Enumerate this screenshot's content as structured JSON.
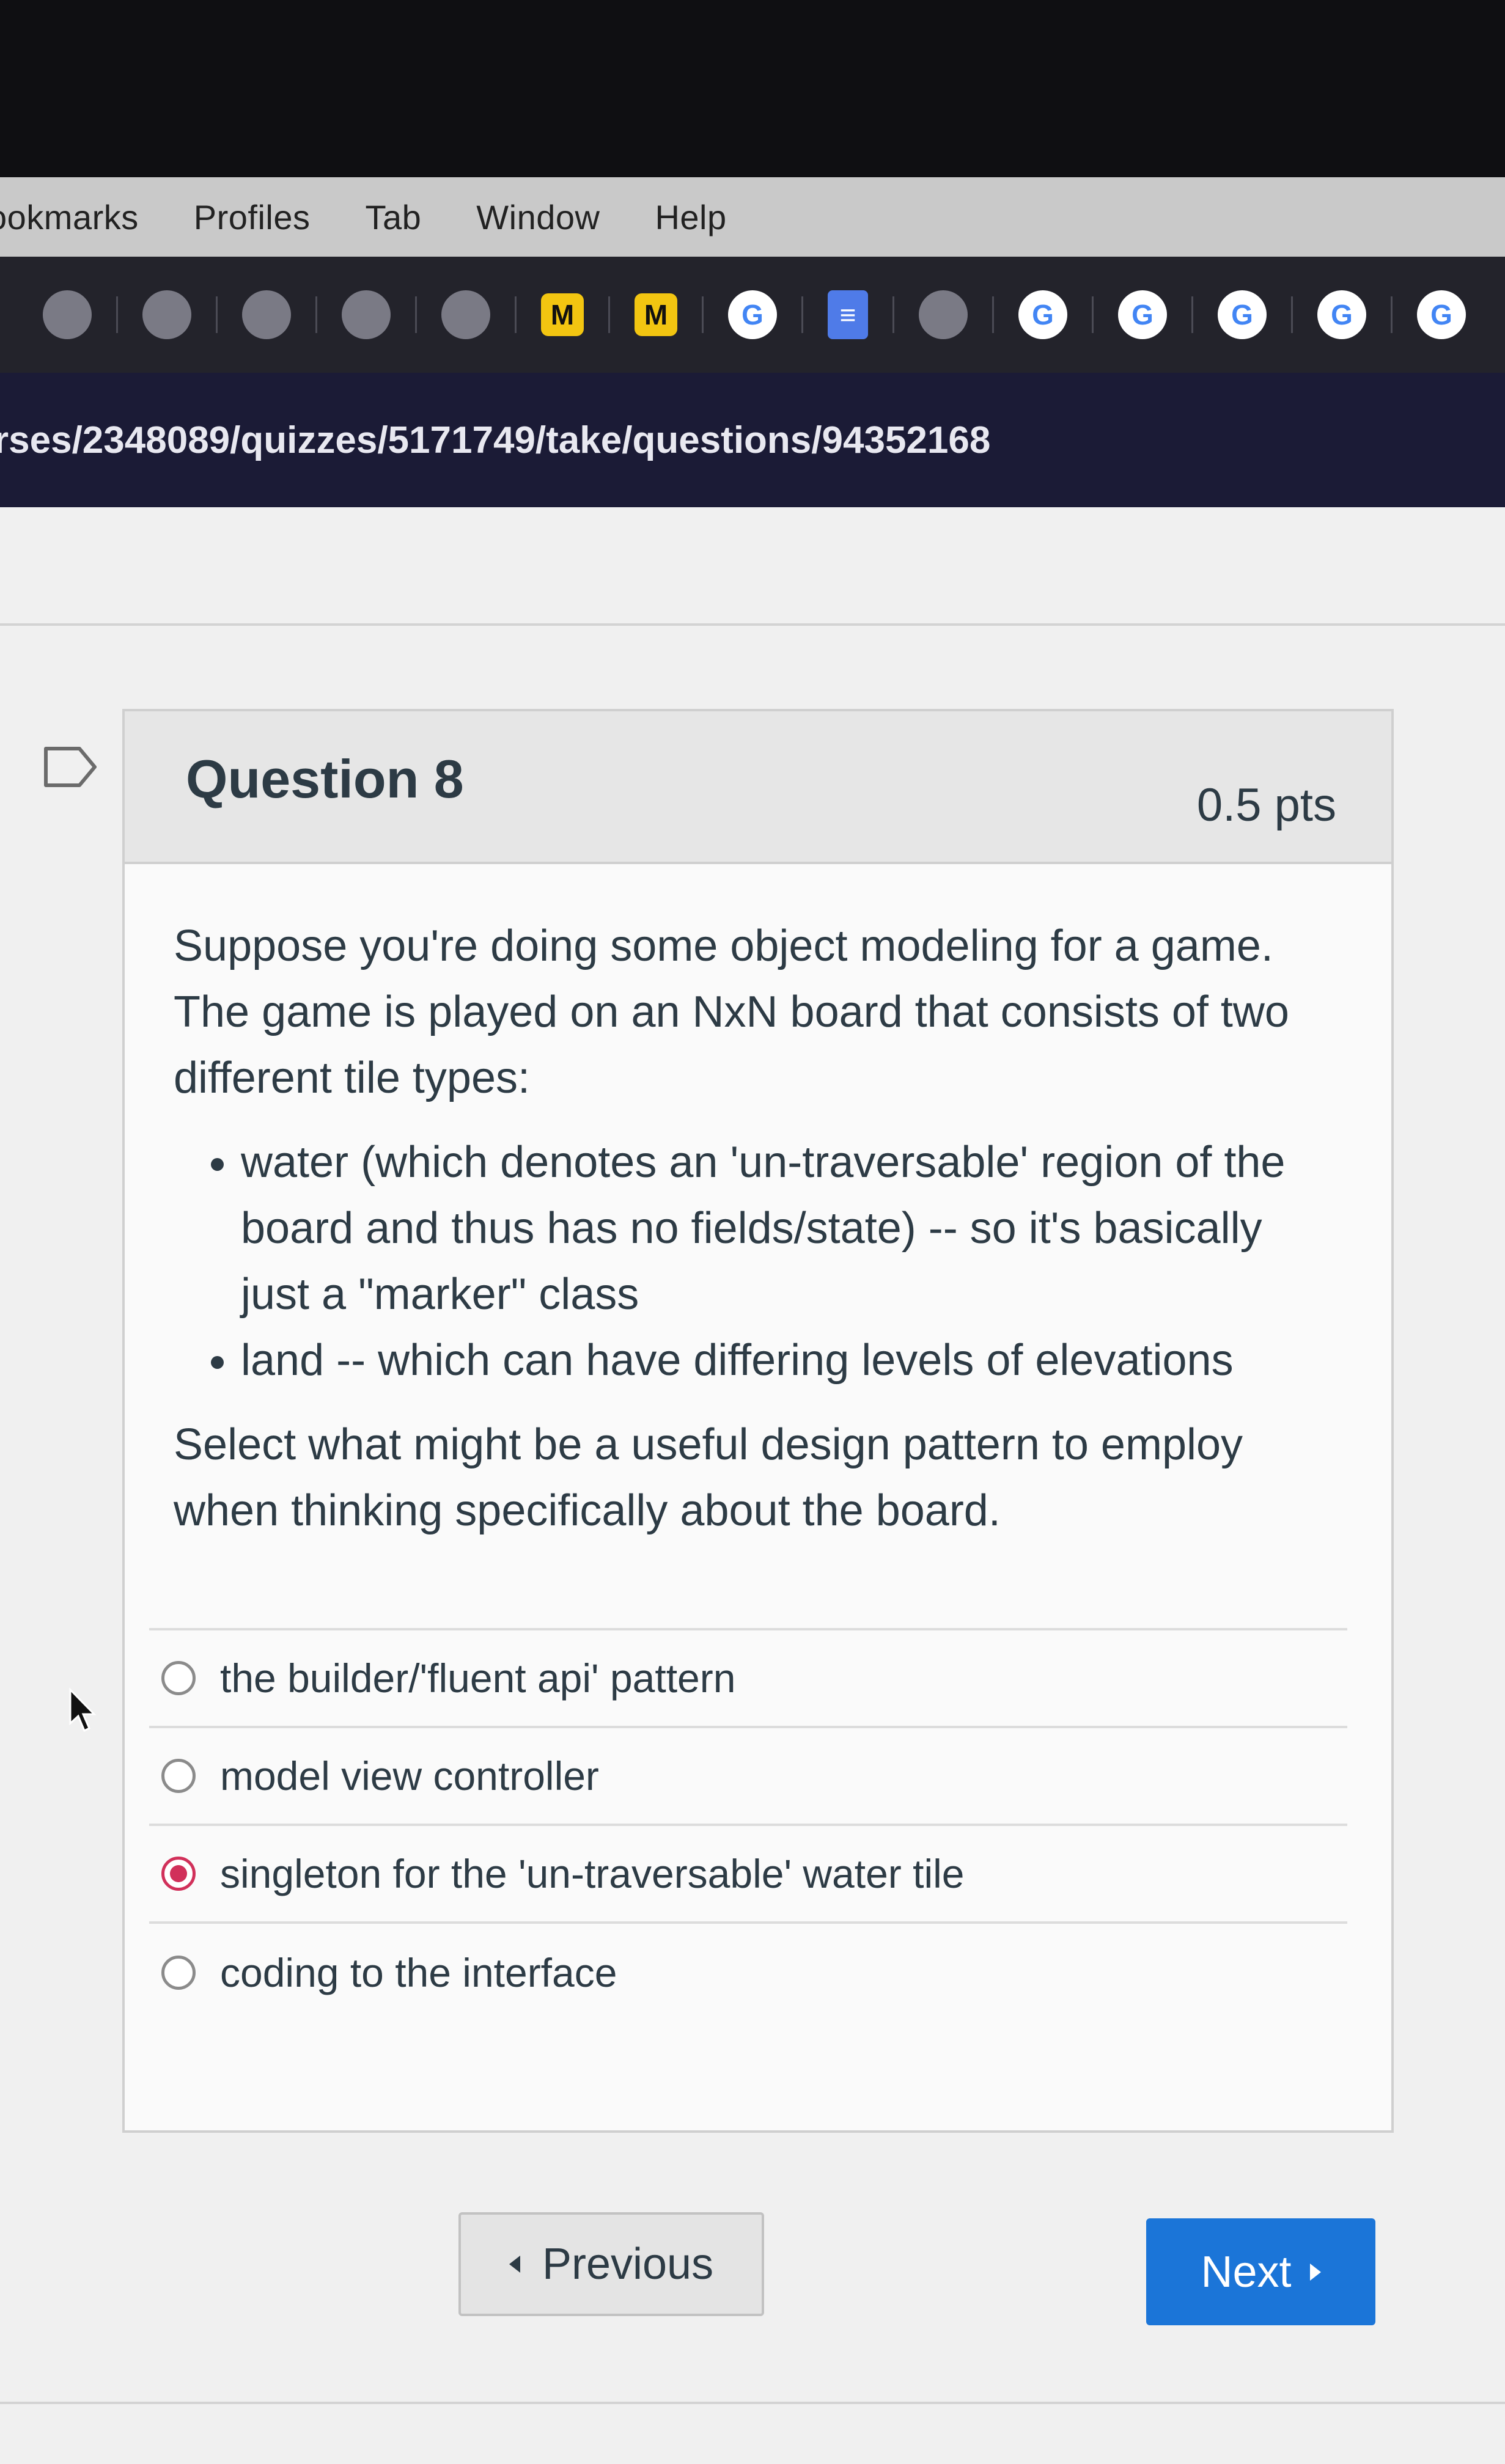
{
  "menubar": {
    "items": [
      "ookmarks",
      "Profiles",
      "Tab",
      "Window",
      "Help"
    ]
  },
  "tabs": {
    "icons": [
      {
        "name": "browser-tab-icon"
      },
      {
        "name": "browser-tab-icon"
      },
      {
        "name": "browser-tab-icon"
      },
      {
        "name": "browser-tab-icon"
      },
      {
        "name": "browser-tab-icon"
      },
      {
        "name": "yellow-tab-icon",
        "glyph": "M"
      },
      {
        "name": "yellow-tab-icon",
        "glyph": "M"
      },
      {
        "name": "google-tab-icon",
        "glyph": "G"
      },
      {
        "name": "docs-tab-icon",
        "glyph": "≡"
      },
      {
        "name": "browser-tab-icon"
      },
      {
        "name": "google-tab-icon",
        "glyph": "G"
      },
      {
        "name": "google-tab-icon",
        "glyph": "G"
      },
      {
        "name": "google-tab-icon",
        "glyph": "G"
      },
      {
        "name": "google-tab-icon",
        "glyph": "G"
      },
      {
        "name": "google-tab-icon",
        "glyph": "G"
      }
    ]
  },
  "address_bar": {
    "url": "rses/2348089/quizzes/5171749/take/questions/94352168"
  },
  "question": {
    "title": "Question 8",
    "points": "0.5 pts",
    "intro": "Suppose you're doing some object modeling for a game. The game is played on an NxN board that consists of two different tile types:",
    "bullets": [
      "water (which denotes an 'un-traversable' region of the board and thus has no fields/state) -- so it's basically just a \"marker\" class",
      "land -- which can have differing levels of elevations"
    ],
    "prompt": "Select what might be a useful design pattern to employ when thinking specifically about the board."
  },
  "answers": [
    {
      "label": "the builder/'fluent api' pattern",
      "selected": false
    },
    {
      "label": "model view controller",
      "selected": false
    },
    {
      "label": "singleton for the 'un-traversable' water tile",
      "selected": true
    },
    {
      "label": "coding to the interface",
      "selected": false
    }
  ],
  "navigation": {
    "previous_label": "Previous",
    "next_label": "Next"
  },
  "colors": {
    "accent_blue": "#1b75d8",
    "selected_radio": "#d1305a",
    "text": "#2d3b45"
  }
}
